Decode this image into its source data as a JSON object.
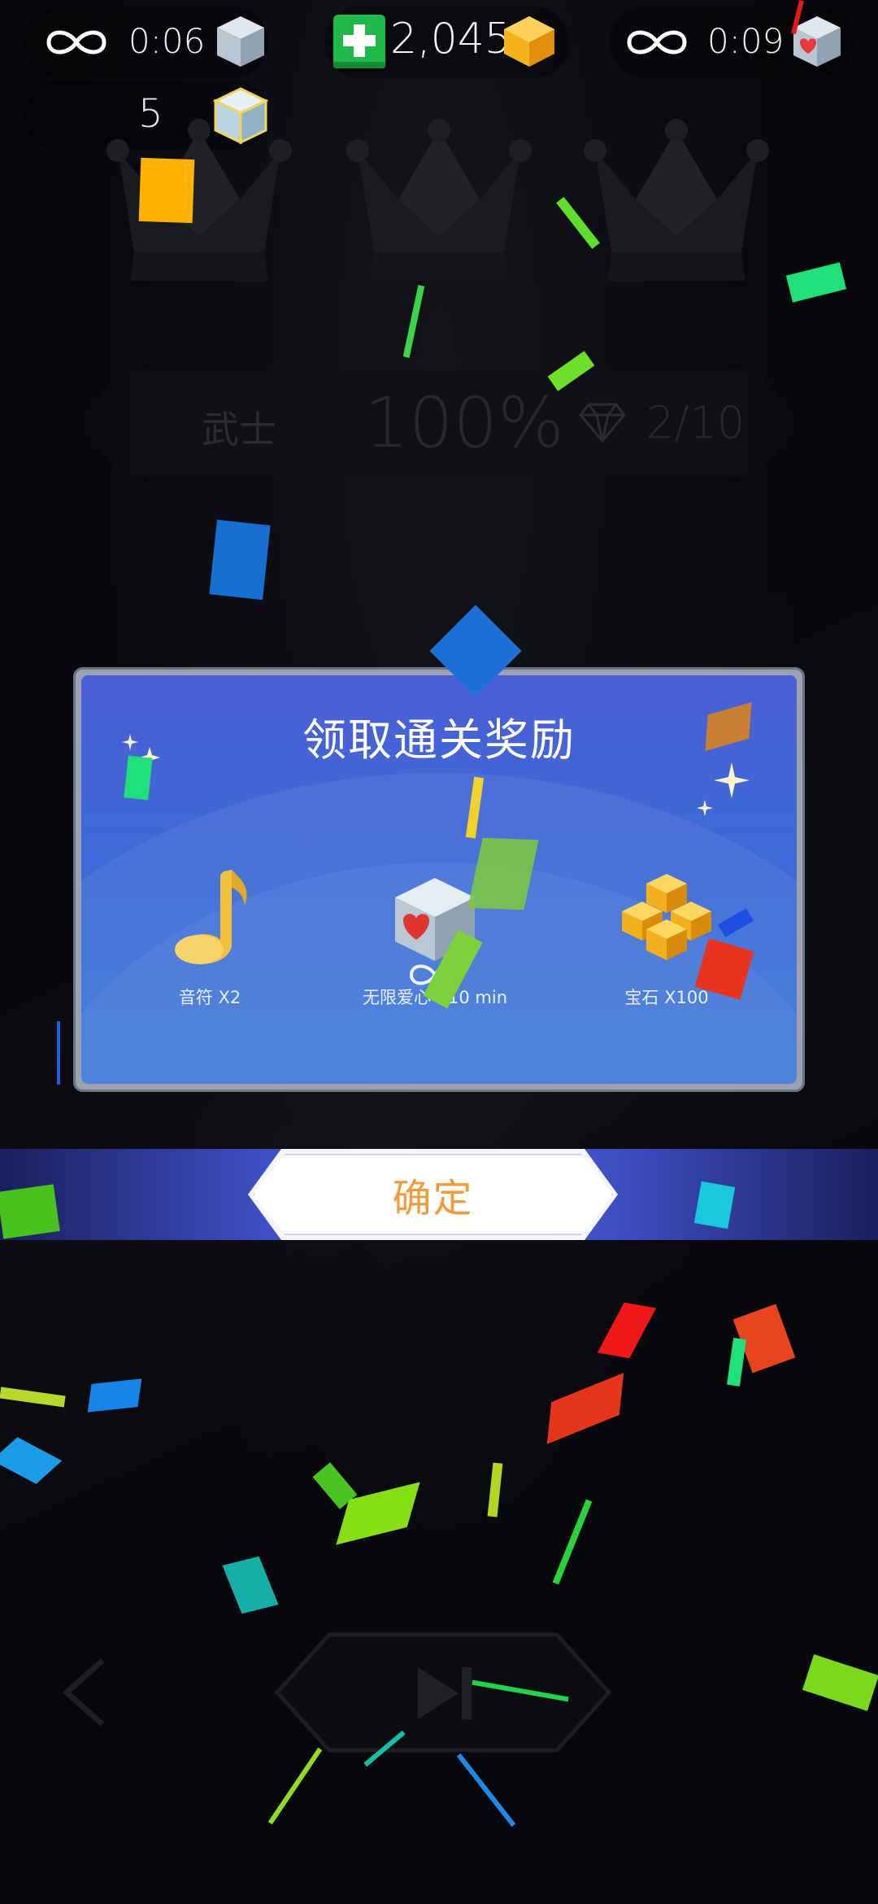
{
  "top_bar": {
    "left_timer": "0:06",
    "gem_count": "2,045",
    "right_timer": "0:09",
    "cube_count": "5",
    "icons": {
      "left_infinity": "infinity-icon",
      "left_cube": "ice-cube-icon",
      "add_gems": "plus-icon",
      "gem": "gold-gem-icon",
      "right_infinity": "infinity-icon",
      "right_cube": "heart-cube-icon",
      "cube_bag": "ice-cube-icon"
    }
  },
  "crowns": {
    "count": 3,
    "earned": 0
  },
  "level_stats": {
    "rank": "武士",
    "completion": "100%",
    "diamonds": "2/10"
  },
  "reward_dialog": {
    "title": "领取通关奖励",
    "rewards": [
      {
        "label": "音符 X2",
        "icon": "music-note-icon"
      },
      {
        "label": "无限爱心 X10 min",
        "icon": "heart-cube-icon"
      },
      {
        "label": "宝石 X100",
        "icon": "gem-pile-icon"
      }
    ]
  },
  "confirm_button": {
    "label": "确定"
  },
  "bottom_controls": {
    "back": "chevron-left-icon",
    "next": "skip-next-icon"
  },
  "colors": {
    "dialog_top": "#4a5fd4",
    "dialog_bottom": "#3a78d8",
    "confirm_text": "#f39b3c",
    "gem_gold": "#f6b21c",
    "plus_green": "#1fb84a"
  }
}
